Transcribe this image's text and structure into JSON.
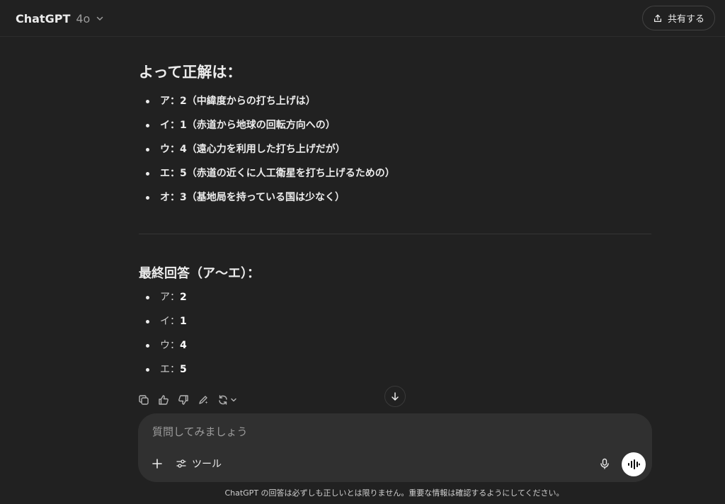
{
  "header": {
    "model_name": "ChatGPT",
    "model_version": "4o",
    "share_label": "共有する"
  },
  "message": {
    "answer_heading": "よって正解は：",
    "answer_items": [
      "ア：2（中緯度からの打ち上げは）",
      "イ：1（赤道から地球の回転方向への）",
      "ウ：4（遠心力を利用した打ち上げだが）",
      "エ：5（赤道の近くに人工衛星を打ち上げるための）",
      "オ：3（基地局を持っている国は少なく）"
    ],
    "final_heading": "最終回答（ア〜エ）：",
    "final_items": [
      {
        "key": "ア：",
        "value": "2"
      },
      {
        "key": "イ：",
        "value": "1"
      },
      {
        "key": "ウ：",
        "value": "4"
      },
      {
        "key": "エ：",
        "value": "5"
      }
    ]
  },
  "actions": {
    "icons": [
      "copy-icon",
      "thumbs-up-icon",
      "thumbs-down-icon",
      "edit-canvas-icon",
      "regenerate-icon"
    ]
  },
  "composer": {
    "placeholder": "質問してみましょう",
    "value": "",
    "tools_label": "ツール"
  },
  "footer": {
    "disclaimer": "ChatGPT の回答は必ずしも正しいとは限りません。重要な情報は確認するようにしてください。"
  },
  "colors": {
    "background": "#212121",
    "composer_bg": "#303030",
    "text": "#ececec",
    "muted": "#9b9b9b"
  }
}
